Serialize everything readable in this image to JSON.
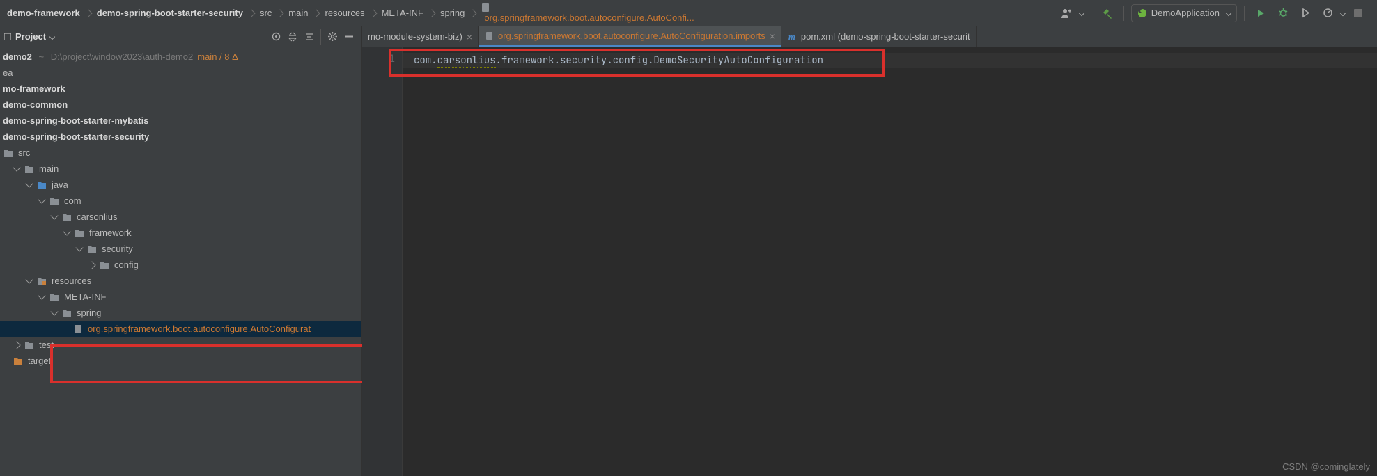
{
  "breadcrumbs": {
    "p0": "demo-framework",
    "p1": "demo-spring-boot-starter-security",
    "p2": "src",
    "p3": "main",
    "p4": "resources",
    "p5": "META-INF",
    "p6": "spring",
    "p7": "org.springframework.boot.autoconfigure.AutoConfi..."
  },
  "runconf": {
    "name": "DemoApplication"
  },
  "tool": {
    "title": "Project",
    "root": {
      "name": "demo2",
      "path": "D:\\project\\window2023\\auth-demo2",
      "branch": "main / 8 Δ"
    },
    "nodes": {
      "ea": "ea",
      "mo_framework": "mo-framework",
      "demo_common": "demo-common",
      "demo_mybatis": "demo-spring-boot-starter-mybatis",
      "demo_security": "demo-spring-boot-starter-security",
      "src": "src",
      "main": "main",
      "java": "java",
      "com": "com",
      "carsonlius": "carsonlius",
      "framework": "framework",
      "security": "security",
      "config": "config",
      "resources": "resources",
      "metainf": "META-INF",
      "spring": "spring",
      "autoconf": "org.springframework.boot.autoconfigure.AutoConfigurat",
      "test": "test",
      "target": "target"
    }
  },
  "tabs": {
    "t0": "mo-module-system-biz)",
    "t1": "org.springframework.boot.autoconfigure.AutoConfiguration.imports",
    "t2": "pom.xml (demo-spring-boot-starter-securit"
  },
  "editor": {
    "lineno": "1",
    "code_prefix": "com.",
    "code_warn": "carsonlius",
    "code_rest": ".framework.security.config.DemoSecurityAutoConfiguration"
  },
  "watermark": "CSDN @cominglately"
}
